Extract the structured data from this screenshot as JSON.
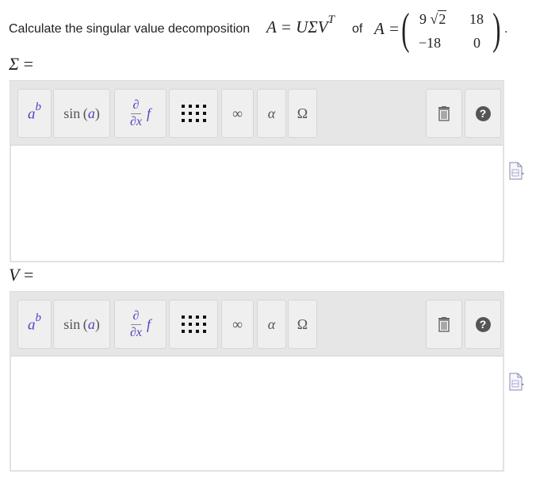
{
  "question": {
    "text": "Calculate the singular value decomposition",
    "equation": "A = UΣV",
    "equation_sup": "T",
    "of_label": "of",
    "A_eq": "A =",
    "matrix": {
      "r1c1_coef": "9",
      "r1c1_rad": "2",
      "r1c2": "18",
      "r2c1": "−18",
      "r2c2": "0"
    },
    "end_punct": "."
  },
  "answers": [
    {
      "label_symbol": "Σ",
      "label_eq": "=",
      "value": ""
    },
    {
      "label_symbol": "V",
      "label_eq": "=",
      "value": ""
    }
  ],
  "toolbar": {
    "power_base": "a",
    "power_exp": "b",
    "sin_fn": "sin",
    "sin_arg": "a",
    "frac_num": "∂",
    "frac_den": "∂x",
    "frac_f": "f",
    "infinity": "∞",
    "alpha": "α",
    "omega": "Ω",
    "help": "?"
  },
  "icons": {
    "matrix": "matrix-grid-icon",
    "trash": "trash-icon",
    "help": "help-circle-icon",
    "doc": "document-icon"
  },
  "colors": {
    "accent_purple": "#5b3fbf",
    "toolbar_bg": "#e6e6e6"
  }
}
